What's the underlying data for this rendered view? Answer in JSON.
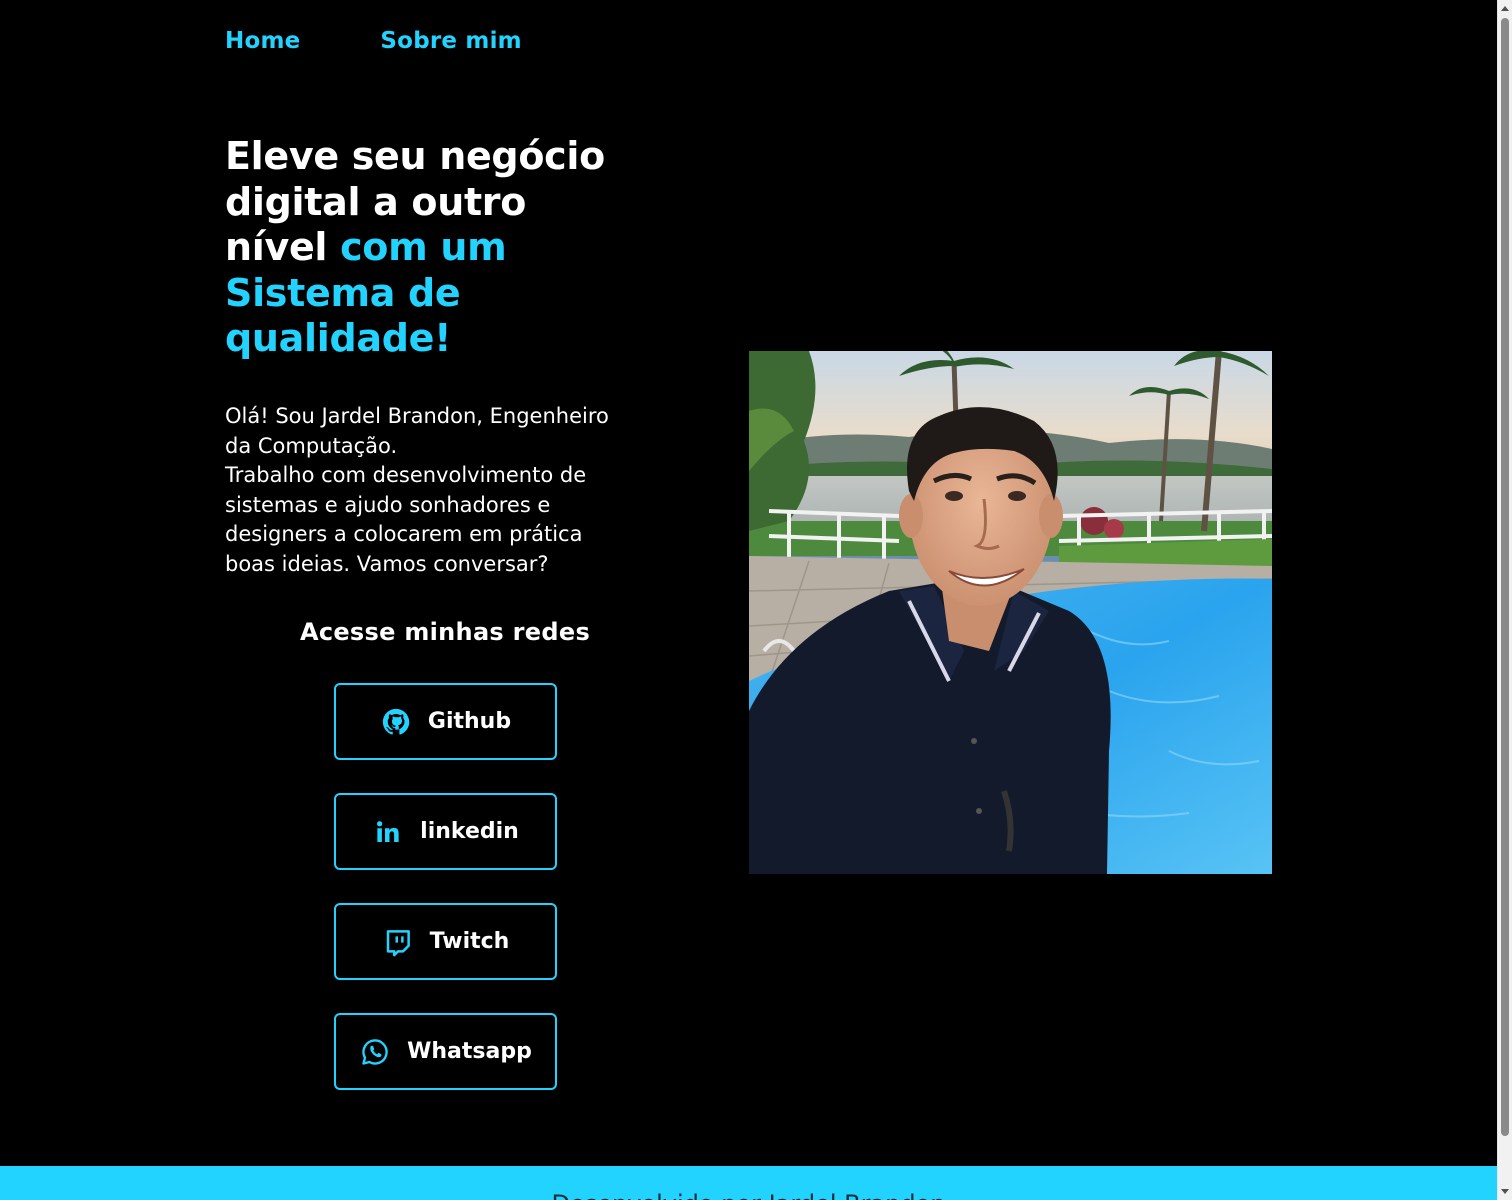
{
  "nav": {
    "items": [
      {
        "label": "Home"
      },
      {
        "label": "Sobre mim"
      }
    ]
  },
  "hero": {
    "headline_lines": [
      {
        "white": "Eleve seu negócio",
        "accent": ""
      },
      {
        "white": "digital a outro",
        "accent": ""
      },
      {
        "white": "nível ",
        "accent": "com um"
      },
      {
        "white": "",
        "accent": "Sistema de"
      },
      {
        "white": "",
        "accent": "qualidade!"
      }
    ],
    "intro_lines": [
      "Olá! Sou Jardel Brandon, Engenheiro",
      "da Computação.",
      "Trabalho com desenvolvimento de",
      "sistemas e ajudo sonhadores e",
      "designers a colocarem em prática",
      "boas ideias. Vamos conversar?"
    ]
  },
  "social": {
    "title": "Acesse minhas redes",
    "buttons": [
      {
        "label": "Github",
        "icon": "github-icon"
      },
      {
        "label": "linkedin",
        "icon": "linkedin-icon"
      },
      {
        "label": "Twitch",
        "icon": "twitch-icon"
      },
      {
        "label": "Whatsapp",
        "icon": "whatsapp-icon"
      }
    ]
  },
  "footer": {
    "text": "Desenvolvido por Jardel Brandon"
  },
  "colors": {
    "accent": "#22d3ff",
    "background": "#000000",
    "text": "#ffffff"
  }
}
